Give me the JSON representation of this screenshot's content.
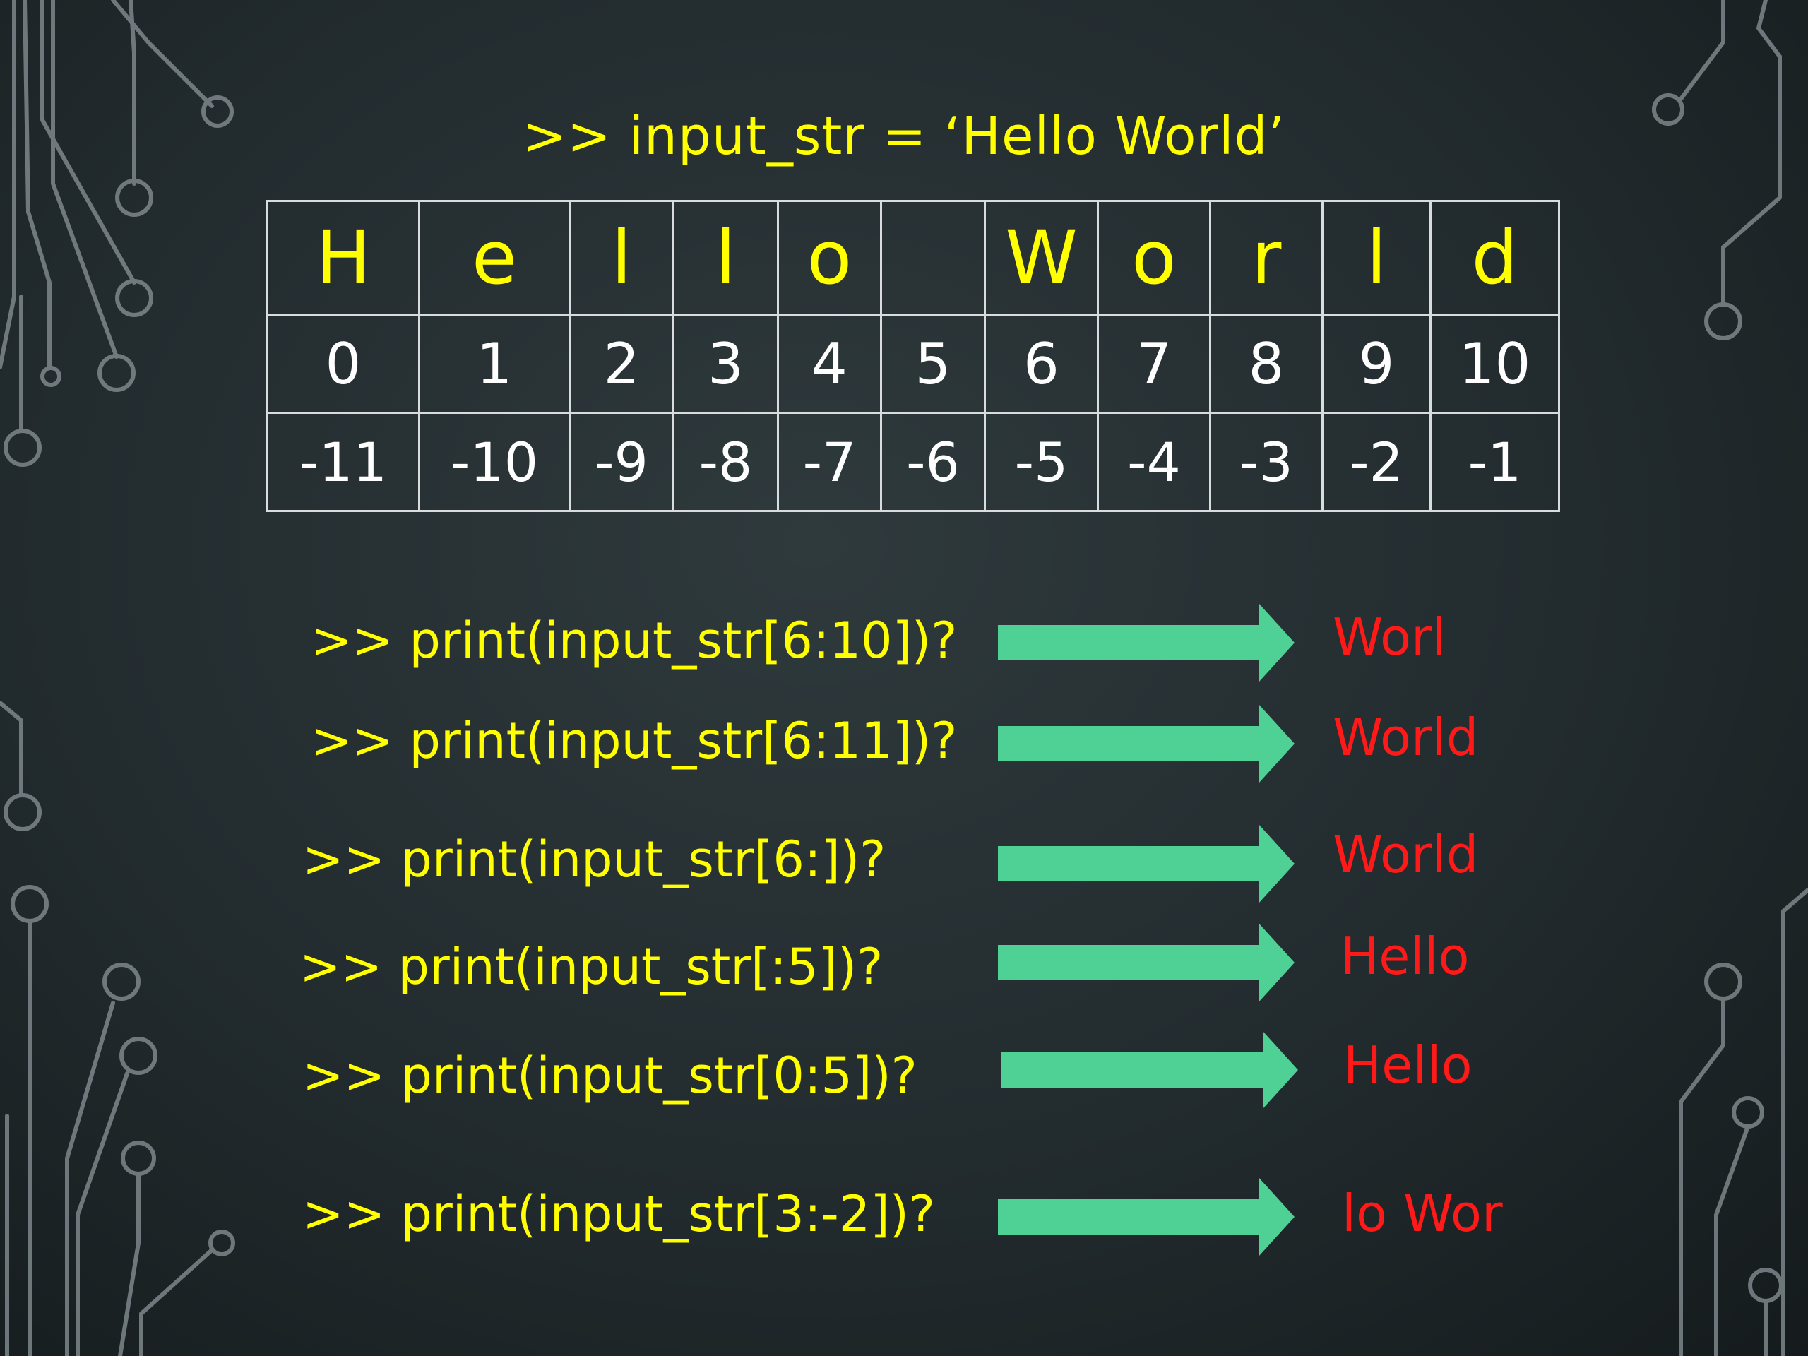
{
  "header": ">> input_str = ‘Hello World’",
  "table": {
    "chars": [
      "H",
      "e",
      "l",
      "l",
      "o",
      "",
      "W",
      "o",
      "r",
      "l",
      "d"
    ],
    "positive_indices": [
      "0",
      "1",
      "2",
      "3",
      "4",
      "5",
      "6",
      "7",
      "8",
      "9",
      "10"
    ],
    "negative_indices": [
      "-11",
      "-10",
      "-9",
      "-8",
      "-7",
      "-6",
      "-5",
      "-4",
      "-3",
      "-2",
      "-1"
    ]
  },
  "questions": [
    {
      "prompt": ">> print(input_str[6:10])?",
      "answer": "Worl"
    },
    {
      "prompt": ">> print(input_str[6:11])?",
      "answer": "World"
    },
    {
      "prompt": ">> print(input_str[6:])?",
      "answer": "World"
    },
    {
      "prompt": ">> print(input_str[:5])?",
      "answer": "Hello"
    },
    {
      "prompt": ">> print(input_str[0:5])?",
      "answer": "Hello"
    },
    {
      "prompt": ">> print(input_str[3:-2])?",
      "answer": "lo Wor"
    }
  ],
  "colors": {
    "prompt": "#ffff00",
    "answer": "#ff1a1a",
    "arrow": "#4fd196",
    "background": "#222b2e",
    "circuit": "#8a9498"
  }
}
